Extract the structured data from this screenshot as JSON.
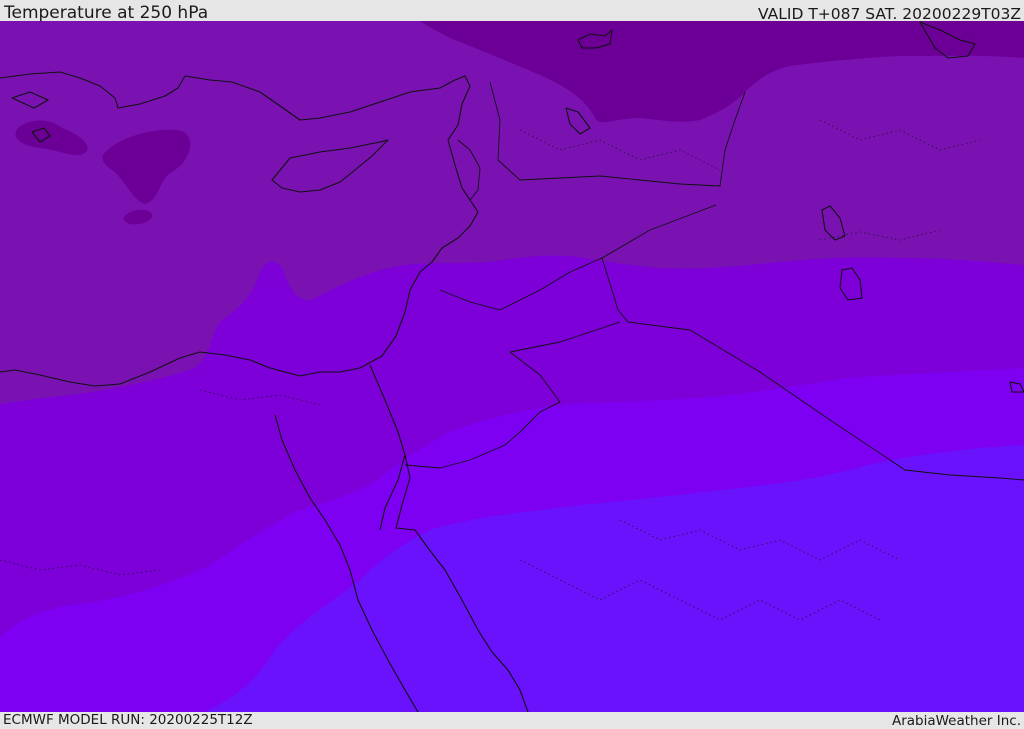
{
  "header": {
    "title": "Temperature at 250 hPa",
    "valid_time": "VALID T+087 SAT. 20200229T03Z"
  },
  "footer": {
    "model_run": "ECMWF MODEL RUN: 20200225T12Z",
    "provider": "ArabiaWeather Inc."
  },
  "map": {
    "fill_colors": {
      "level_1": "#6c0096",
      "level_2": "#7a12b2",
      "level_3": "#7d00d8",
      "level_4": "#7e00f3",
      "level_5": "#6a12fb"
    },
    "border_color": "#111111"
  }
}
